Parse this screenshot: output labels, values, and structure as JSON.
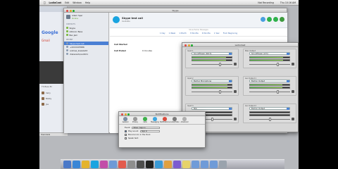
{
  "menubar": {
    "app": "LadioCast",
    "items": [
      "Edit",
      "Window",
      "Help"
    ],
    "right": [
      "Not Recording",
      "Thu 10:16 AM"
    ]
  },
  "chrome": {
    "logo": "Google",
    "gmail": "Gmail",
    "side_text": "TS Bass Bl",
    "rows": [
      "Carly",
      "Bobby",
      "Joe"
    ],
    "status": "Downloads"
  },
  "skype": {
    "title": "Skype",
    "me_name": "Adam Sper",
    "me_status": "Online",
    "contacts_header": "CONTACTS",
    "contacts": [
      "Skype",
      "Adbonic Bass",
      "Ben Jam",
      "RECENT"
    ],
    "calls": [
      "Skype test call",
      "+2XXXXX5586",
      "andrew_kowaleXX",
      "ctakanishi/andXX1"
    ],
    "call_title": "Skype test call",
    "call_sub": "Available",
    "filter_top": "Show Earlier Messages",
    "filters": [
      "1 Day",
      "1 Week",
      "1 Month",
      "3 Months",
      "6 Months",
      "1 Year",
      "From Beginning"
    ],
    "messages": [
      {
        "who": "Call Started",
        "text": ""
      },
      {
        "who": "Call Ended",
        "text": "0 minutes"
      }
    ],
    "button_colors": [
      "#4aa0e0",
      "#2fb24c",
      "#2fb24c",
      "#3e9a3e"
    ]
  },
  "ladio": {
    "title": "LadioCast",
    "inputs": [
      {
        "label": "Input 1",
        "device": "Soundflower (64ch)",
        "level": 0.86
      },
      {
        "label": "Input 2",
        "device": "Built-in Microphone",
        "level": 0.9
      },
      {
        "label": "Input 3",
        "device": "N/A",
        "level": 0.0
      }
    ],
    "outputs": [
      {
        "label": "Main Output",
        "device": "Soundflower (2ch)",
        "level": 0.84
      },
      {
        "label": "Aux Output 1",
        "device": "Built-in Output",
        "level": 0.82
      },
      {
        "label": "Aux Output 2",
        "device": "Built-in Output",
        "level": 0.0
      }
    ]
  },
  "prefs": {
    "title": "Notifications",
    "toolbar": [
      "General",
      "Privacy",
      "Calls",
      "Messaging",
      "Notifications",
      "Audio/Video",
      "Advanced"
    ],
    "toolbar_colors": [
      "#7d8fa3",
      "#999",
      "#3eb04b",
      "#3ea7e0",
      "#d94b3d",
      "#7a7a7a",
      "#b0b0b0"
    ],
    "event_label": "Event:",
    "event_value": "When I Sign In",
    "rows": [
      {
        "label": "Play sound:",
        "value": "Sign In",
        "checked": true
      },
      {
        "label": "Bounce icon in the Dock",
        "value": "",
        "checked": false
      },
      {
        "label": "Speak text:",
        "value": "",
        "checked": false
      }
    ]
  },
  "dock": {
    "icons": [
      "finder-icon",
      "appstore-icon",
      "chrome-icon",
      "skype-icon",
      "itunes-icon",
      "mail-icon",
      "calendar-icon",
      "settings-icon",
      "ladiocast-icon",
      "terminal-icon",
      "safari-icon",
      "photos-icon",
      "music-icon",
      "notes-icon",
      "folder-icon",
      "folder-icon",
      "folder-icon",
      "trash-icon"
    ],
    "colors": [
      "#4a78c8",
      "#3a86d6",
      "#e4b32d",
      "#19a4e0",
      "#c24ea8",
      "#6e9ad6",
      "#e35b4d",
      "#8e8e8e",
      "#4d4d4d",
      "#222",
      "#3a9ad6",
      "#e0a040",
      "#7c5bd0",
      "#e6d36a",
      "#6f9bd8",
      "#6f9bd8",
      "#6f9bd8",
      "#9aa3ad"
    ]
  }
}
